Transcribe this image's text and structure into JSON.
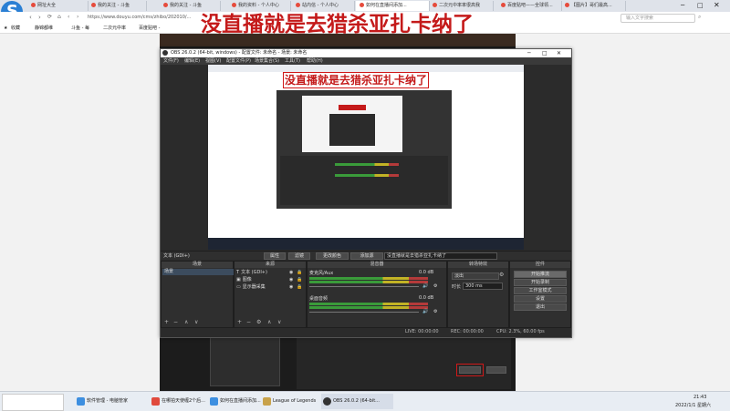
{
  "browser": {
    "tabs": [
      "网址大全",
      "我的关注 - 斗鱼",
      "我的关注 - 斗鱼",
      "我的资料 - 个人中心",
      "站内信 - 个人中心",
      "如何在直播间添加...",
      "二次元中率率很高我",
      "百度贴吧——全球领...",
      "【图片】哥们最高..."
    ],
    "active_tab": 5,
    "address": "https://www.douyu.com/cms/zhibo/202010/...",
    "search_placeholder": "输入文字搜索",
    "bookmarks": [
      "收藏",
      "静锦都维",
      "斗鱼 - 每",
      "二次元中率",
      "百度贴吧 -"
    ]
  },
  "page": {
    "headline": "没直播就是去猎杀亚扎卡纳了"
  },
  "obs": {
    "title": "OBS 26.0.2 (64-bit, windows) - 配置文件: 未命名 - 场景: 未命名",
    "menu": [
      "文件(F)",
      "编辑(E)",
      "视图(V)",
      "配置文件(P)",
      "场景集合(S)",
      "工具(T)",
      "帮助(H)"
    ],
    "preview_headline": "没直播就是去猎杀亚扎卡纳了",
    "source_toolbar": {
      "selected": "文本 (GDI+)",
      "buttons": [
        "属性",
        "滤镜",
        "更改颜色",
        "添加源"
      ],
      "text_value": "没直播就是去猎杀亚扎卡纳了"
    },
    "docks": {
      "scenes": {
        "title": "场景",
        "items": [
          "场景"
        ]
      },
      "sources": {
        "title": "来源",
        "items": [
          "文本 (GDI+)",
          "图像",
          "显示器采集"
        ]
      },
      "mixer": {
        "title": "混音器",
        "tracks": [
          {
            "name": "桌面音频",
            "db": "0.0 dB"
          },
          {
            "name": "麦克风/Aux",
            "db": "0.0 dB"
          }
        ]
      },
      "transitions": {
        "title": "转场特效",
        "type": "淡出",
        "duration_label": "时长",
        "duration": "300 ms"
      },
      "controls": {
        "title": "控件",
        "buttons": [
          "开始推流",
          "开始录制",
          "工作室模式",
          "设置",
          "退出"
        ]
      }
    },
    "status": {
      "live": "LIVE: 00:00:00",
      "rec": "REC: 00:00:00",
      "cpu": "CPU: 2.3%, 60.00 fps"
    }
  },
  "taskbar": {
    "items": [
      "软件管理 - 电脑管家",
      "在哪拍天使缠2个后...",
      "如何在直播间添加...",
      "League of Legends",
      "OBS 26.0.2 (64-bit..."
    ],
    "time": "21:43",
    "date": "2022/1/1 星期六"
  },
  "colors": {
    "accent": "#c41a1a",
    "obs_bg": "#2b2b2b",
    "browser_blue": "#2a7fd4"
  }
}
